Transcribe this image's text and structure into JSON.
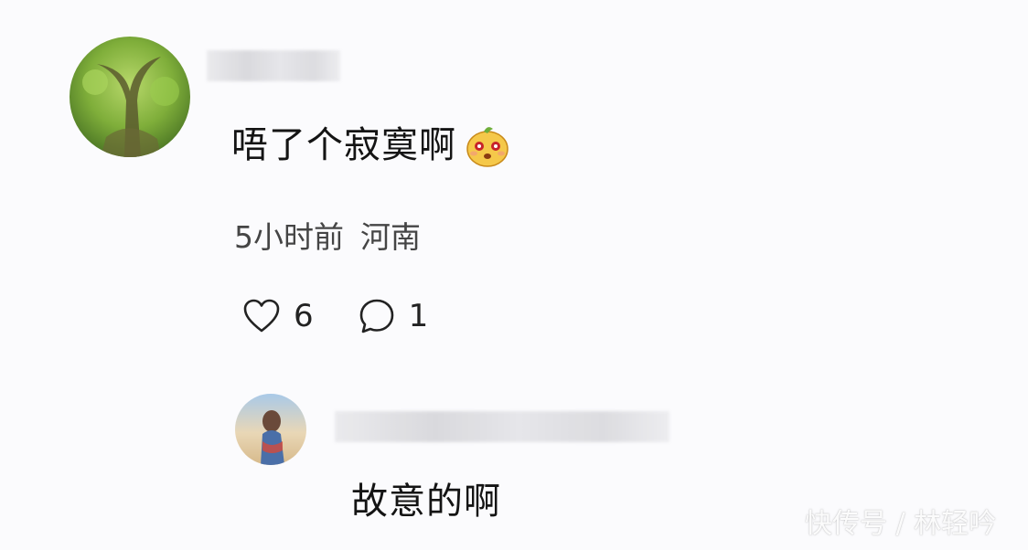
{
  "comment": {
    "text": "唔了个寂寞啊",
    "emoji_icon": "surprised-face-emoji",
    "time": "5小时前",
    "location": "河南",
    "likes": "6",
    "replies": "1"
  },
  "reply": {
    "text": "故意的啊"
  },
  "watermark": "快传号 / 林轻吟"
}
